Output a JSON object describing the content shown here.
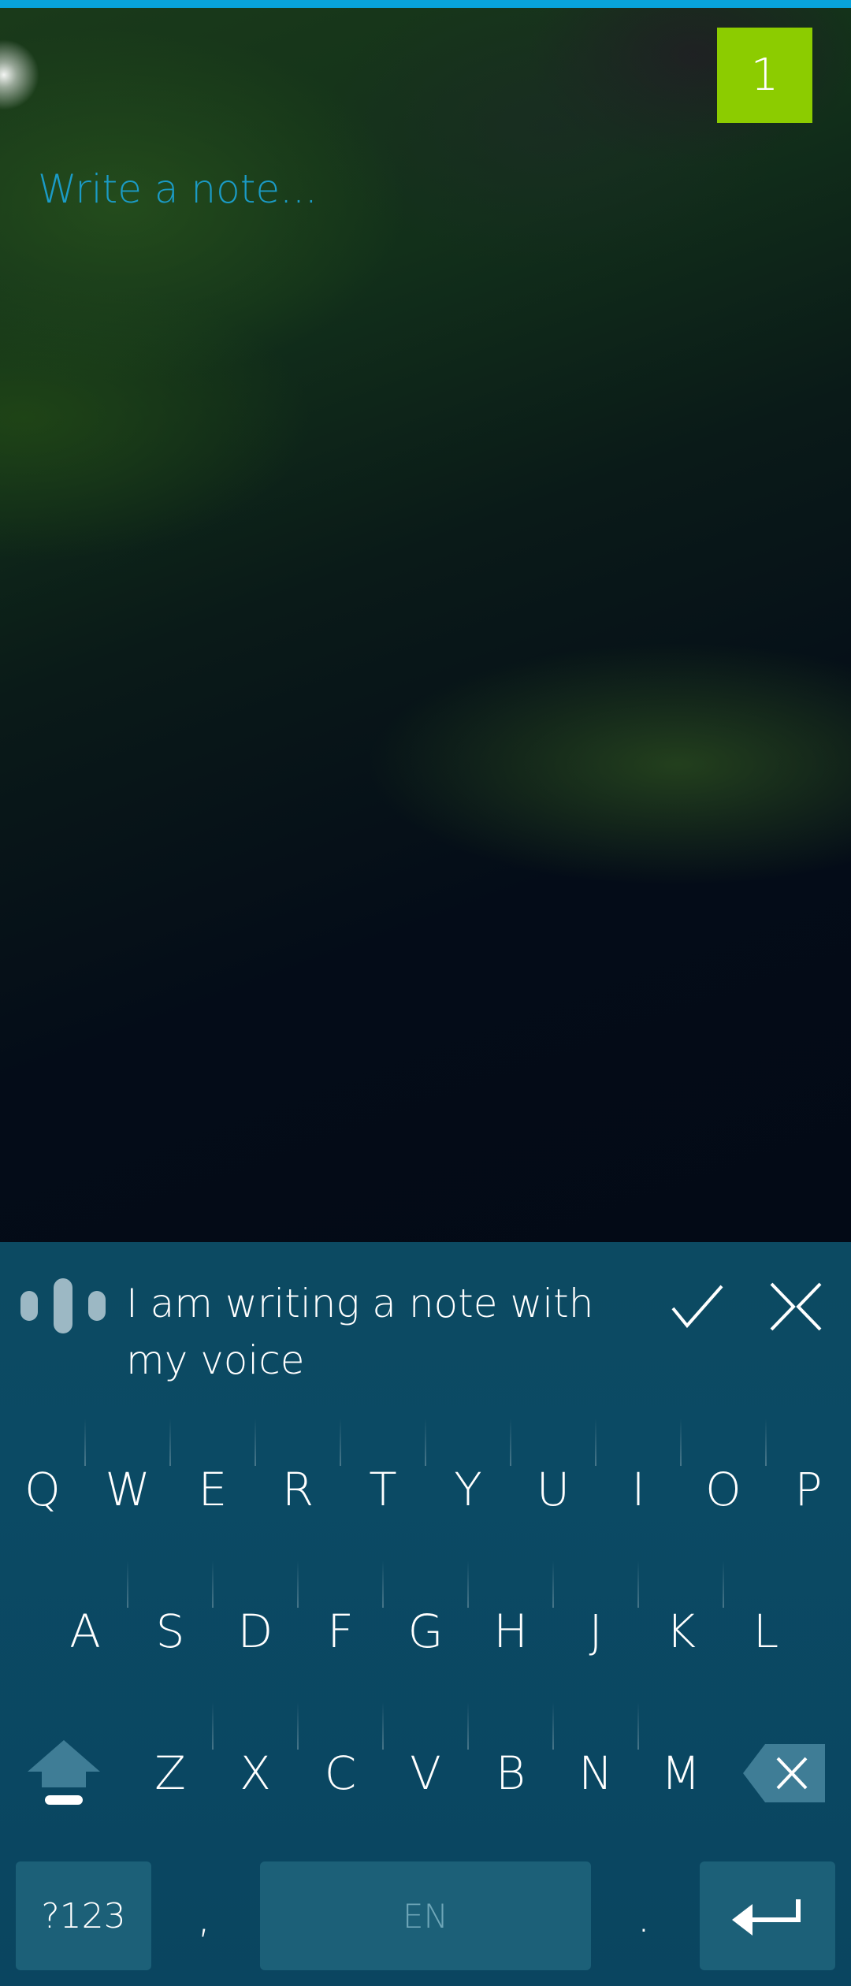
{
  "notification": {
    "count": "1"
  },
  "note": {
    "placeholder": "Write a note..."
  },
  "voice_input": {
    "transcript": "I am writing a note with my voice"
  },
  "keyboard": {
    "row1": [
      "Q",
      "W",
      "E",
      "R",
      "T",
      "Y",
      "U",
      "I",
      "O",
      "P"
    ],
    "row2": [
      "A",
      "S",
      "D",
      "F",
      "G",
      "H",
      "J",
      "K",
      "L"
    ],
    "row3": [
      "Z",
      "X",
      "C",
      "V",
      "B",
      "N",
      "M"
    ],
    "symbols_label": "?123",
    "comma": ",",
    "space_label": "EN",
    "period": "."
  },
  "colors": {
    "accent": "#08a3db",
    "badge": "#8ccc00",
    "placeholder": "#1b9bc6",
    "keyboard_bg": "#0b4a64"
  },
  "icons": {
    "mic": "voice-level-icon",
    "accept": "checkmark-icon",
    "discard": "close-icon",
    "shift": "shift-arrow-icon",
    "backspace": "backspace-icon",
    "enter": "enter-arrow-icon"
  }
}
